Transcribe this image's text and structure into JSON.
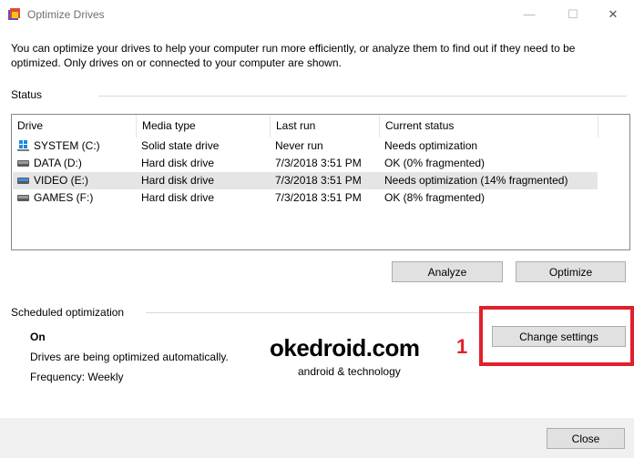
{
  "window": {
    "title": "Optimize Drives",
    "controls": {
      "minimize": "—",
      "maximize": "☐",
      "close": "✕"
    }
  },
  "intro_text": "You can optimize your drives to help your computer run more efficiently, or analyze them to find out if they need to be optimized. Only drives on or connected to your computer are shown.",
  "status": {
    "label": "Status",
    "columns": [
      "Drive",
      "Media type",
      "Last run",
      "Current status"
    ],
    "rows": [
      {
        "drive": "SYSTEM (C:)",
        "media": "Solid state drive",
        "last_run": "Never run",
        "status": "Needs optimization",
        "icon": "windows-drive-icon"
      },
      {
        "drive": "DATA (D:)",
        "media": "Hard disk drive",
        "last_run": "7/3/2018 3:51 PM",
        "status": "OK (0% fragmented)",
        "icon": "hard-drive-icon"
      },
      {
        "drive": "VIDEO (E:)",
        "media": "Hard disk drive",
        "last_run": "7/3/2018 3:51 PM",
        "status": "Needs optimization (14% fragmented)",
        "icon": "hard-drive-icon",
        "selected": true
      },
      {
        "drive": "GAMES (F:)",
        "media": "Hard disk drive",
        "last_run": "7/3/2018 3:51 PM",
        "status": "OK (8% fragmented)",
        "icon": "hard-drive-icon"
      }
    ]
  },
  "buttons": {
    "analyze": "Analyze",
    "optimize": "Optimize",
    "change_settings": "Change settings",
    "close": "Close"
  },
  "scheduled": {
    "label": "Scheduled optimization",
    "state": "On",
    "description": "Drives are being optimized automatically.",
    "frequency": "Frequency: Weekly"
  },
  "watermark": {
    "main": "okedroid.com",
    "sub": "android & technology"
  },
  "annotation": {
    "marker": "1",
    "color": "#e0202c"
  }
}
